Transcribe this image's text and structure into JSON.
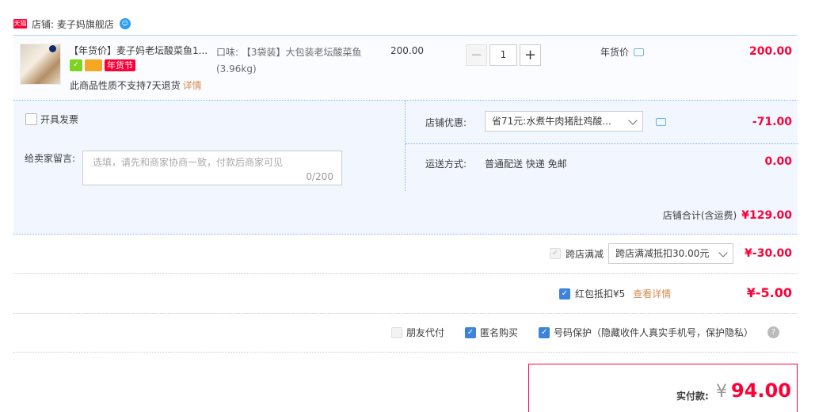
{
  "store": {
    "badge": "天猫",
    "label": "店铺: 麦子妈旗舰店"
  },
  "item": {
    "title": "【年货价】麦子妈老坛酸菜鱼1...",
    "festival_tag": "年货节",
    "no_return": "此商品性质不支持7天退货",
    "detail_link": "详情",
    "spec": "口味: 【3袋装】大包装老坛酸菜鱼(3.96kg)",
    "unit_price": "200.00",
    "quantity": "1",
    "price_tag": "年货价",
    "total": "200.00"
  },
  "invoice": {
    "label": "开具发票"
  },
  "message": {
    "label": "给卖家留言:",
    "placeholder": "选填，请先和商家协商一致，付款后商家可见",
    "count": "0/200"
  },
  "shop_discount": {
    "label": "店铺优惠:",
    "selected": "省71元:水煮牛肉猪肚鸡酸...",
    "amount": "-71.00"
  },
  "shipping": {
    "label": "运送方式:",
    "value": "普通配送 快递 免邮",
    "amount": "0.00"
  },
  "subtotal": {
    "label": "店铺合计(含运费)",
    "amount": "¥129.00"
  },
  "cross_store": {
    "label": "跨店满减",
    "selected": "跨店满减抵扣30.00元",
    "amount": "¥-30.00"
  },
  "red_packet": {
    "label": "红包抵扣¥5",
    "link": "查看详情",
    "amount": "¥-5.00"
  },
  "options": {
    "friend_pay": "朋友代付",
    "anonymous": "匿名购买",
    "number_protect": "号码保护（隐藏收件人真实手机号，保护隐私）"
  },
  "payment": {
    "label": "实付款:",
    "currency": "¥",
    "amount": "94.00"
  }
}
